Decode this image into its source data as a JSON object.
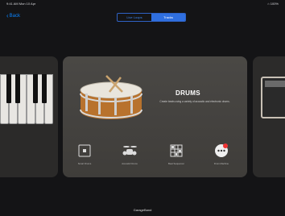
{
  "status_bar": {
    "time": "9:41 AM  Mon 10 Apr",
    "right": "⌂ 100%"
  },
  "nav": {
    "back_label": "Back",
    "segments": [
      "Live Loops",
      "Tracks"
    ],
    "active_segment": 1
  },
  "main_card": {
    "title": "DRUMS",
    "description": "Create beats using a variety of acoustic and electronic drums.",
    "presets": [
      {
        "label": "Smart Drums",
        "icon": "smart-drums-icon"
      },
      {
        "label": "Acoustic Drums",
        "icon": "drum-kit-icon"
      },
      {
        "label": "Beat Sequencer",
        "icon": "beat-sequencer-icon"
      },
      {
        "label": "Drum Machine",
        "icon": "more-options-icon",
        "badge": true
      }
    ]
  },
  "footer": {
    "text": "GarageBand"
  }
}
